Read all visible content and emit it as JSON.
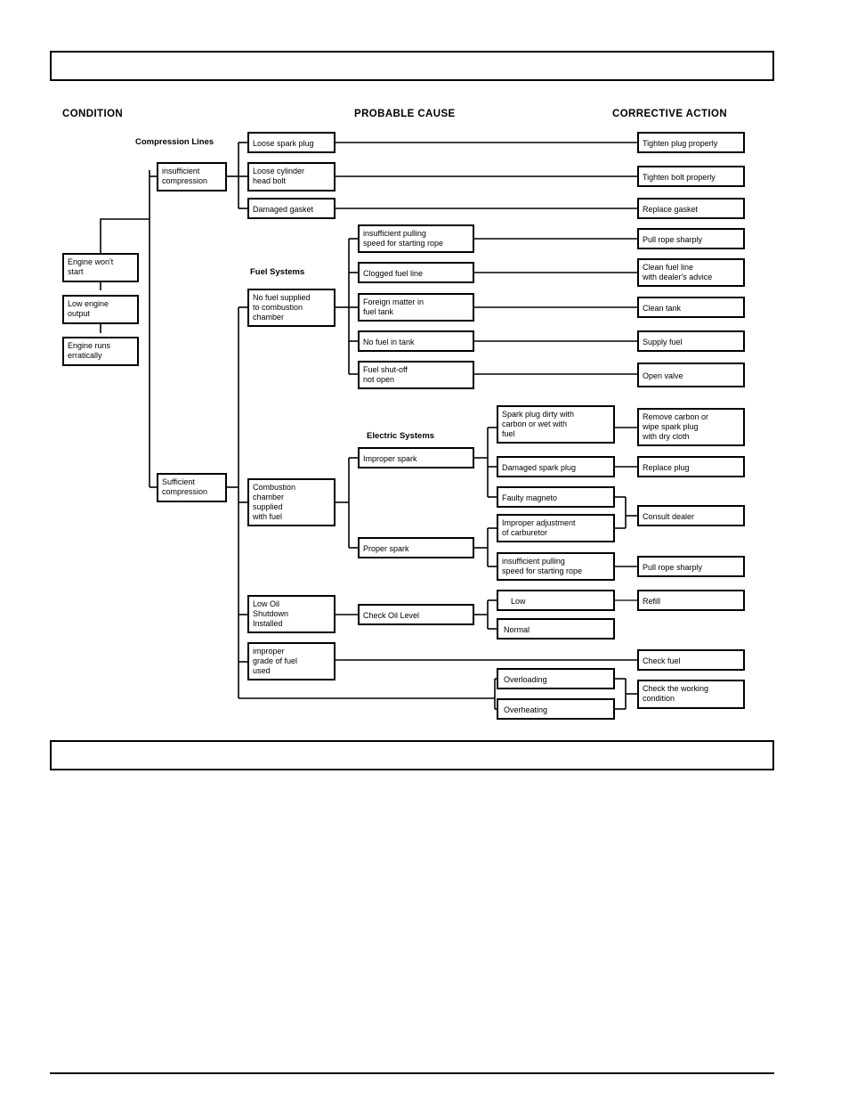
{
  "page": {
    "header_bar": "",
    "footer_bar": ""
  },
  "headers": {
    "condition": "CONDITION",
    "probable_cause": "PROBABLE CAUSE",
    "corrective_action": "CORRECTIVE ACTION"
  },
  "group_labels": {
    "compression_lines": "Compression Lines",
    "fuel_systems": "Fuel Systems",
    "electric_systems": "Electric Systems"
  },
  "condition_boxes": [
    {
      "id": "engine-wont-start",
      "lines": [
        "Engine won't",
        "start"
      ]
    },
    {
      "id": "low-engine-output",
      "lines": [
        "Low engine",
        "output"
      ]
    },
    {
      "id": "engine-runs-erratically",
      "lines": [
        "Engine runs",
        "erratically"
      ]
    }
  ],
  "branch_boxes": [
    {
      "id": "insufficient-compression",
      "lines": [
        "insufficient",
        "compression"
      ]
    },
    {
      "id": "sufficient-compression",
      "lines": [
        "Sufficient",
        "compression"
      ]
    }
  ],
  "cause_boxes": [
    {
      "id": "loose-spark-plug",
      "lines": [
        "Loose spark plug"
      ]
    },
    {
      "id": "loose-cylinder-head-bolt",
      "lines": [
        "Loose cylinder",
        "head bolt"
      ]
    },
    {
      "id": "damaged-gasket",
      "lines": [
        "Damaged gasket"
      ]
    },
    {
      "id": "no-fuel-supplied",
      "lines": [
        "No fuel supplied",
        "to combustion",
        "chamber"
      ]
    },
    {
      "id": "insufficient-pulling-speed-1",
      "lines": [
        "insufficient pulling",
        "speed for starting rope"
      ]
    },
    {
      "id": "clogged-fuel-line",
      "lines": [
        "Clogged fuel line"
      ]
    },
    {
      "id": "foreign-matter-in-fuel-tank",
      "lines": [
        "Foreign matter in",
        "fuel tank"
      ]
    },
    {
      "id": "no-fuel-in-tank",
      "lines": [
        "No fuel in tank"
      ]
    },
    {
      "id": "fuel-shutoff-not-open",
      "lines": [
        "Fuel shut-off",
        "not open"
      ]
    },
    {
      "id": "combustion-chamber-supplied-with-fuel",
      "lines": [
        "Combustion",
        "chamber",
        "supplied",
        "with fuel"
      ]
    },
    {
      "id": "improper-spark",
      "lines": [
        "Improper spark"
      ]
    },
    {
      "id": "proper-spark",
      "lines": [
        "Proper spark"
      ]
    },
    {
      "id": "spark-plug-dirty",
      "lines": [
        "Spark plug dirty with",
        "carbon or wet with",
        "fuel"
      ]
    },
    {
      "id": "damaged-spark-plug",
      "lines": [
        "Damaged spark plug"
      ]
    },
    {
      "id": "faulty-magneto",
      "lines": [
        "Faulty magneto"
      ]
    },
    {
      "id": "improper-adjustment-of-carburetor",
      "lines": [
        "Improper adjustment",
        "of carburetor"
      ]
    },
    {
      "id": "insufficient-pulling-speed-2",
      "lines": [
        "insufficient pulling",
        "speed for starting rope"
      ]
    },
    {
      "id": "low-oil-shutdown-installed",
      "lines": [
        "Low Oil",
        "Shutdown",
        "Installed"
      ]
    },
    {
      "id": "check-oil-level",
      "lines": [
        "Check Oil Level"
      ]
    },
    {
      "id": "oil-low",
      "lines": [
        "Low"
      ]
    },
    {
      "id": "oil-normal",
      "lines": [
        "Normal"
      ]
    },
    {
      "id": "improper-grade-of-fuel-used",
      "lines": [
        "improper",
        "grade of fuel",
        "used"
      ]
    },
    {
      "id": "overloading",
      "lines": [
        "Overloading"
      ]
    },
    {
      "id": "overheating",
      "lines": [
        "Overheating"
      ]
    }
  ],
  "action_boxes": [
    {
      "id": "tighten-plug-properly",
      "lines": [
        "Tighten plug properly"
      ]
    },
    {
      "id": "tighten-bolt-properly",
      "lines": [
        "Tighten bolt properly"
      ]
    },
    {
      "id": "replace-gasket",
      "lines": [
        "Replace gasket"
      ]
    },
    {
      "id": "pull-rope-sharply-1",
      "lines": [
        "Pull rope sharply"
      ]
    },
    {
      "id": "clean-fuel-line",
      "lines": [
        "Clean fuel line",
        "with dealer's advice"
      ]
    },
    {
      "id": "clean-tank",
      "lines": [
        "Clean tank"
      ]
    },
    {
      "id": "supply-fuel",
      "lines": [
        "Supply fuel"
      ]
    },
    {
      "id": "open-valve",
      "lines": [
        "Open valve"
      ]
    },
    {
      "id": "remove-carbon",
      "lines": [
        "Remove carbon or",
        "wipe spark plug",
        "with dry cloth"
      ]
    },
    {
      "id": "replace-plug",
      "lines": [
        "Replace plug"
      ]
    },
    {
      "id": "consult-dealer",
      "lines": [
        "Consult dealer"
      ]
    },
    {
      "id": "pull-rope-sharply-2",
      "lines": [
        "Pull rope sharply"
      ]
    },
    {
      "id": "refill",
      "lines": [
        "Refill"
      ]
    },
    {
      "id": "check-fuel",
      "lines": [
        "Check fuel"
      ]
    },
    {
      "id": "check-the-working-condition",
      "lines": [
        "Check the working",
        "condition"
      ]
    }
  ],
  "colors": {
    "ink": "#000000",
    "paper": "#ffffff"
  }
}
